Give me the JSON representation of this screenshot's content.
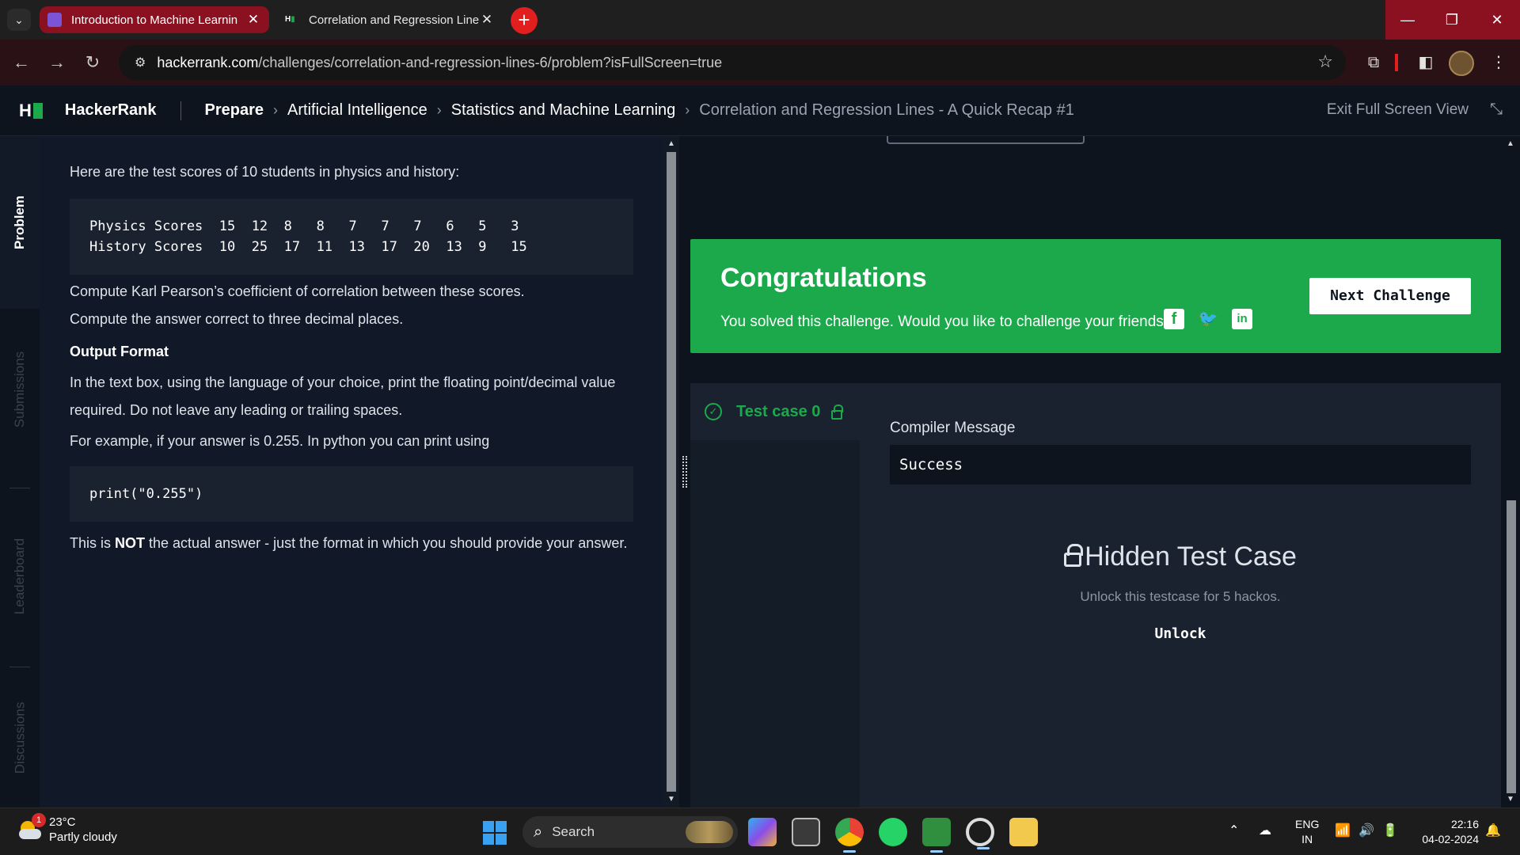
{
  "browser": {
    "tabs": [
      {
        "title": "Introduction to Machine Learnin",
        "active": true
      },
      {
        "title": "Correlation and Regression Line",
        "active": false
      }
    ],
    "url_host": "hackerrank.com",
    "url_path": "/challenges/correlation-and-regression-lines-6/problem?isFullScreen=true"
  },
  "header": {
    "logo": "H",
    "brand": "HackerRank",
    "breadcrumbs": [
      "Prepare",
      "Artificial Intelligence",
      "Statistics and Machine Learning",
      "Correlation and Regression Lines - A Quick Recap #1"
    ],
    "exit_label": "Exit Full Screen View"
  },
  "sidebar": {
    "tabs": [
      "Problem",
      "Submissions",
      "Leaderboard",
      "Discussions"
    ]
  },
  "problem": {
    "intro": "Here are the test scores of 10 students in physics and history:",
    "table_rows": [
      "Physics Scores  15  12  8   8   7   7   7   6   5   3",
      "History Scores  10  25  17  11  13  17  20  13  9   15"
    ],
    "task_line1": "Compute Karl Pearson’s coefficient of correlation between these scores.",
    "task_line2": "Compute the answer correct to three decimal places.",
    "output_heading": "Output Format",
    "output_text": "In the text box, using the language of your choice, print the floating point/decimal value required. Do not leave any leading or trailing spaces.",
    "example_text": "For example, if your answer is 0.255. In python you can print using",
    "example_code": "print(\"0.255\")",
    "note_prefix": "This is ",
    "note_bold": "NOT",
    "note_suffix": " the actual answer - just the format in which you should provide your answer."
  },
  "congrats": {
    "title": "Congratulations",
    "subtitle": "You solved this challenge. Would you like to challenge your friends?",
    "next_label": "Next Challenge"
  },
  "results": {
    "test_case_label": "Test case 0",
    "compiler_label": "Compiler Message",
    "compiler_message": "Success",
    "hidden_title": "Hidden Test Case",
    "hidden_sub": "Unlock this testcase for 5 hackos.",
    "unlock_label": "Unlock"
  },
  "taskbar": {
    "weather_temp": "23°C",
    "weather_desc": "Partly cloudy",
    "weather_badge": "1",
    "search_placeholder": "Search",
    "lang_line1": "ENG",
    "lang_line2": "IN",
    "time": "22:16",
    "date": "04-02-2024"
  },
  "colors": {
    "accent_green": "#1ba94c",
    "active_tab": "#8b1020",
    "background": "#0e141e"
  }
}
